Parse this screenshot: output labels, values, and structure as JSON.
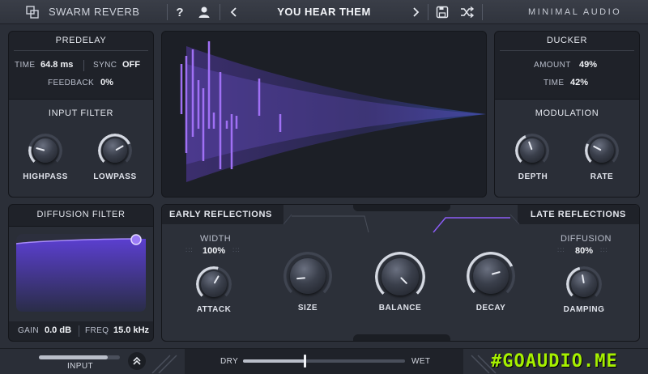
{
  "header": {
    "plugin_name": "SWARM REVERB",
    "help_label": "?",
    "preset_name": "YOU HEAR THEM",
    "brand": "MINIMAL AUDIO"
  },
  "predelay": {
    "title": "PREDELAY",
    "time_label": "TIME",
    "time_value": "64.8 ms",
    "sync_label": "SYNC",
    "sync_value": "OFF",
    "feedback_label": "FEEDBACK",
    "feedback_value": "0%"
  },
  "input_filter": {
    "title": "INPUT FILTER",
    "highpass_label": "HIGHPASS",
    "lowpass_label": "LOWPASS"
  },
  "ducker": {
    "title": "DUCKER",
    "amount_label": "AMOUNT",
    "amount_value": "49%",
    "time_label": "TIME",
    "time_value": "42%"
  },
  "modulation": {
    "title": "MODULATION",
    "depth_label": "DEPTH",
    "rate_label": "RATE"
  },
  "diffusion_filter": {
    "title": "DIFFUSION FILTER",
    "gain_label": "GAIN",
    "gain_value": "0.0 dB",
    "freq_label": "FREQ",
    "freq_value": "15.0 kHz"
  },
  "reflections": {
    "early_title": "EARLY REFLECTIONS",
    "late_title": "LATE REFLECTIONS",
    "width_label": "WIDTH",
    "width_value": "100%",
    "diffusion_label": "DIFFUSION",
    "diffusion_value": "80%",
    "attack_label": "ATTACK",
    "size_label": "SIZE",
    "balance_label": "BALANCE",
    "decay_label": "DECAY",
    "damping_label": "DAMPING"
  },
  "footer": {
    "input_label": "INPUT",
    "dry_label": "DRY",
    "wet_label": "WET",
    "dry_wet_mix": 0.38,
    "input_level": 0.85
  },
  "watermark": "#GOAUDIO.ME",
  "colors": {
    "accent": "#8b5cf6",
    "accent_light": "#a78bfa",
    "panel": "#1f2229",
    "background": "#2b2f38"
  }
}
